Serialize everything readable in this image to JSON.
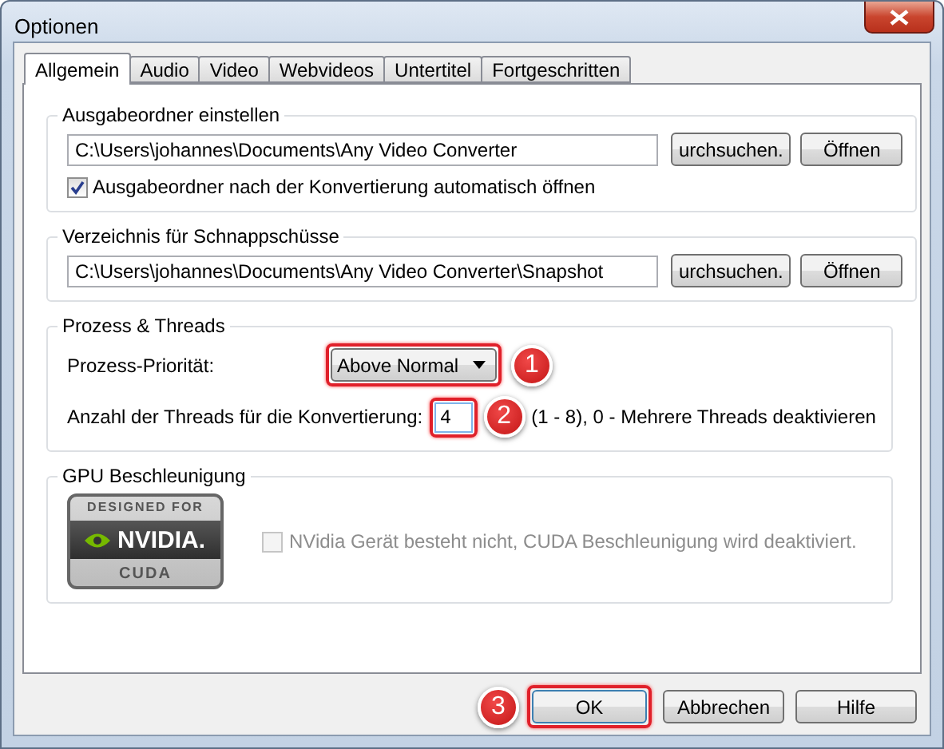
{
  "window": {
    "title": "Optionen"
  },
  "tabs": [
    {
      "label": "Allgemein",
      "selected": true
    },
    {
      "label": "Audio",
      "selected": false
    },
    {
      "label": "Video",
      "selected": false
    },
    {
      "label": "Webvideos",
      "selected": false
    },
    {
      "label": "Untertitel",
      "selected": false
    },
    {
      "label": "Fortgeschritten",
      "selected": false
    }
  ],
  "output_folder": {
    "legend": "Ausgabeordner einstellen",
    "path": "C:\\Users\\johannes\\Documents\\Any Video Converter",
    "browse_button": "urchsuchen.",
    "open_button": "Öffnen",
    "auto_open": {
      "label": "Ausgabeordner nach der Konvertierung automatisch öffnen",
      "checked": true
    }
  },
  "snapshot_folder": {
    "legend": "Verzeichnis für Schnappschüsse",
    "path": "C:\\Users\\johannes\\Documents\\Any Video Converter\\Snapshot",
    "browse_button": "urchsuchen.",
    "open_button": "Öffnen"
  },
  "process": {
    "legend": "Prozess & Threads",
    "priority_label": "Prozess-Priorität:",
    "priority_value": "Above Normal",
    "priority_callout": "1",
    "threads_label": "Anzahl der Threads für die Konvertierung:",
    "threads_value": "4",
    "threads_callout": "2",
    "threads_hint": "(1 - 8), 0 - Mehrere Threads deaktivieren"
  },
  "gpu": {
    "legend": "GPU Beschleunigung",
    "logo": {
      "top": "DESIGNED FOR",
      "brand": "NVIDIA.",
      "bottom": "CUDA"
    },
    "cuda": {
      "label": "NVidia Gerät besteht nicht, CUDA Beschleunigung wird deaktiviert.",
      "checked": false,
      "disabled": true
    }
  },
  "buttons": [
    {
      "label": "OK",
      "callout": "3"
    },
    {
      "label": "Abbrechen"
    },
    {
      "label": "Hilfe"
    }
  ]
}
